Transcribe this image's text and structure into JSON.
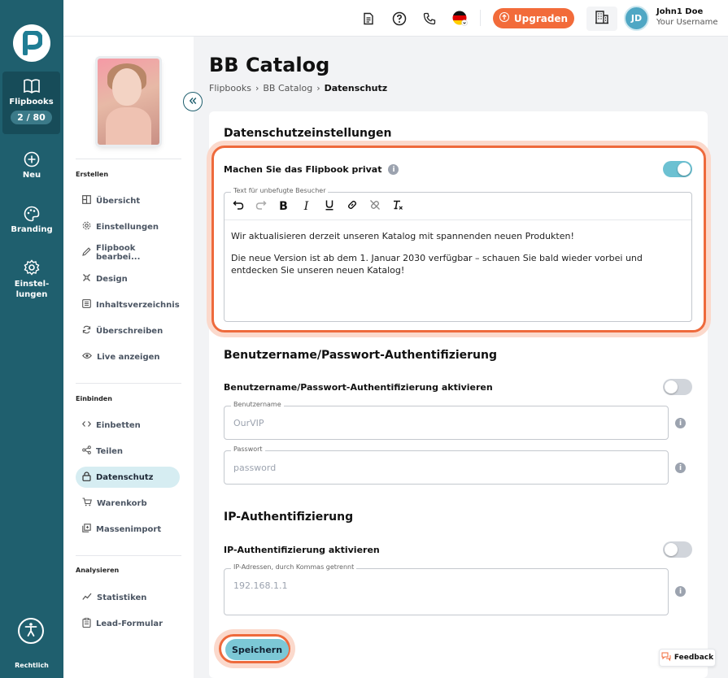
{
  "rail": {
    "flipbooks_label": "Flipbooks",
    "flipbooks_count": "2 / 80",
    "new_label": "Neu",
    "branding_label": "Branding",
    "settings_label": "Einstel-lungen",
    "legal_label": "Rechtlich"
  },
  "topbar": {
    "upgrade_label": "Upgraden",
    "avatar_initials": "JD",
    "user_name": "John1 Doe",
    "user_sub": "Your Username"
  },
  "sidebar": {
    "section_create": "Erstellen",
    "section_embed": "Einbinden",
    "section_analyze": "Analysieren",
    "create_items": [
      "Übersicht",
      "Einstellungen",
      "Flipbook bearbei...",
      "Design",
      "Inhaltsverzeichnis",
      "Überschreiben",
      "Live anzeigen"
    ],
    "embed_items": [
      "Einbetten",
      "Teilen",
      "Datenschutz",
      "Warenkorb",
      "Massenimport"
    ],
    "analyze_items": [
      "Statistiken",
      "Lead-Formular"
    ]
  },
  "page": {
    "title": "BB Catalog",
    "breadcrumb": [
      "Flipbooks",
      "BB Catalog",
      "Datenschutz"
    ]
  },
  "privacy": {
    "heading": "Datenschutzeinstellungen",
    "private_label": "Machen Sie das Flipbook privat",
    "private_on": true,
    "editor_label": "Text für unbefugte Besucher",
    "editor_p1": "Wir aktualisieren derzeit unseren Katalog mit spannenden neuen Produkten!",
    "editor_p2": "Die neue Version ist ab dem 1. Januar 2030 verfügbar – schauen Sie bald wieder vorbei und entdecken Sie unseren neuen Katalog!"
  },
  "auth": {
    "heading": "Benutzername/Passwort-Authentifizierung",
    "toggle_label": "Benutzername/Passwort-Authentifizierung aktivieren",
    "enabled": false,
    "username_label": "Benutzername",
    "username_value": "OurVIP",
    "password_label": "Passwort",
    "password_value": "password"
  },
  "ip": {
    "heading": "IP-Authentifizierung",
    "toggle_label": "IP-Authentifizierung aktivieren",
    "enabled": false,
    "field_label": "IP-Adressen, durch Kommas getrennt",
    "field_value": "192.168.1.1"
  },
  "actions": {
    "save_label": "Speichern",
    "feedback_label": "Feedback"
  },
  "colors": {
    "rail": "#1f5f6e",
    "accent_orange": "#f26b3a",
    "toggle_on": "#6cc1d2",
    "save_button": "#7cc8d6"
  }
}
